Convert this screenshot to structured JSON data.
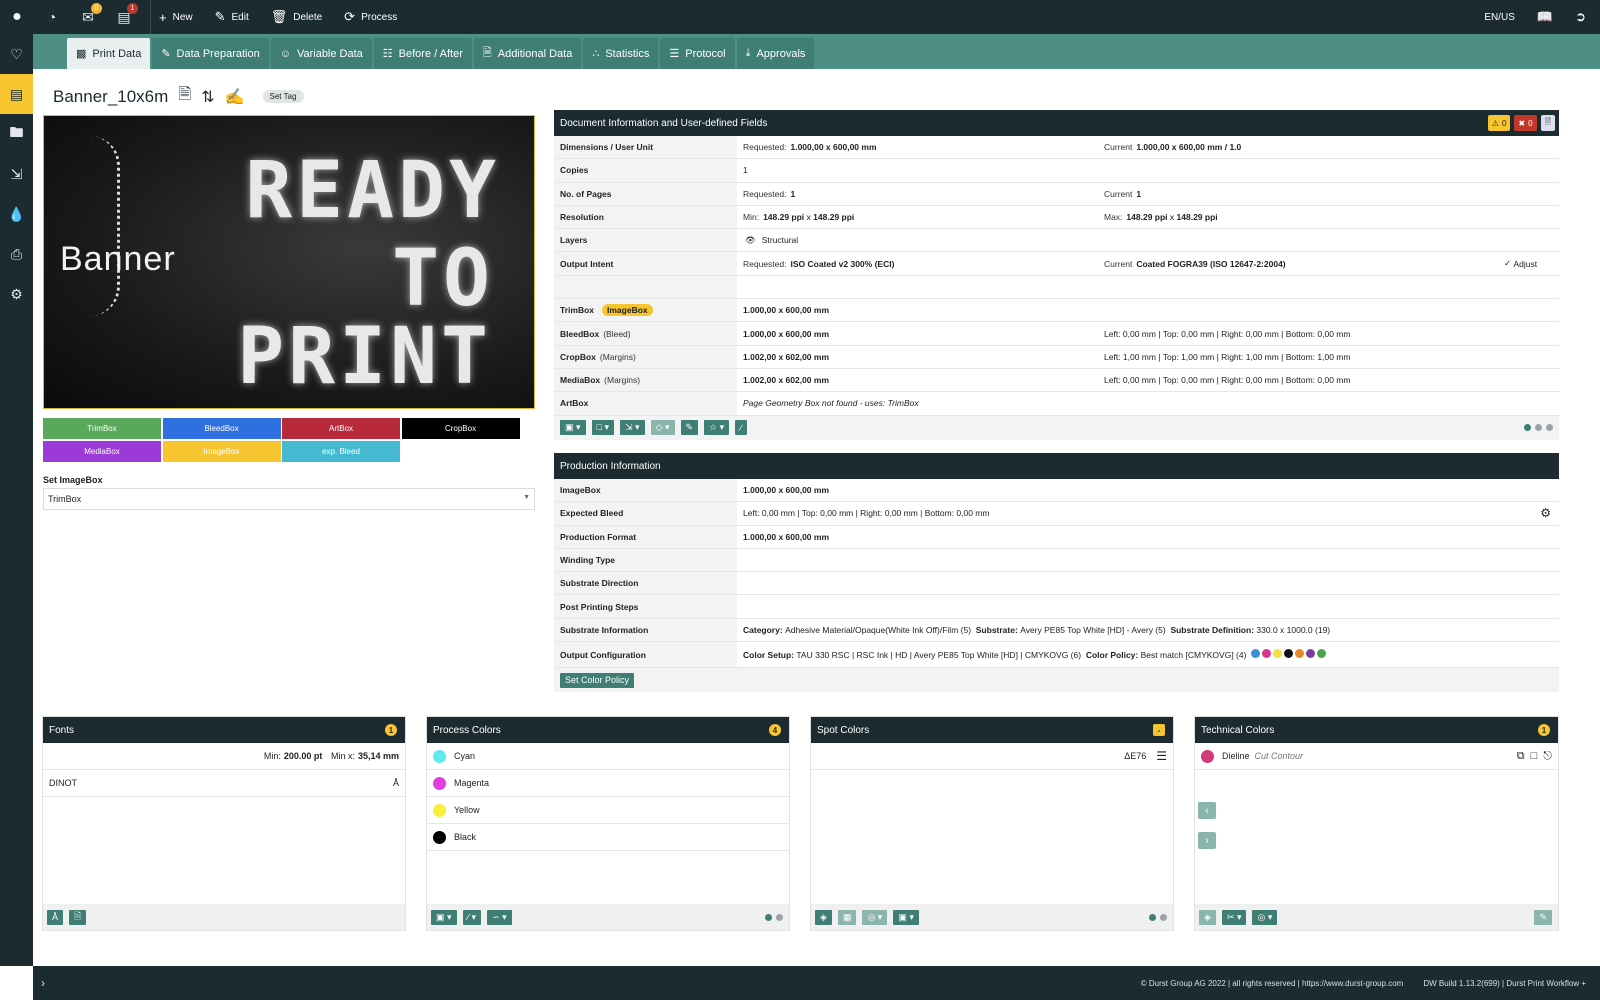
{
  "topbar": {
    "new": "New",
    "edit": "Edit",
    "delete": "Delete",
    "process": "Process",
    "badge_a": "0",
    "badge_b": "1",
    "locale": "EN/US"
  },
  "tabs": [
    "Print Data",
    "Data Preparation",
    "Variable Data",
    "Before / After",
    "Additional Data",
    "Statistics",
    "Protocol",
    "Approvals"
  ],
  "title": {
    "name": "Banner_10x6m",
    "set_tag": "Set Tag"
  },
  "preview": {
    "banner": "Banner",
    "l1": "READY",
    "l2": "TO",
    "l3": "PRINT"
  },
  "boxes": [
    {
      "label": "TrimBox",
      "color": "#5aa85a"
    },
    {
      "label": "BleedBox",
      "color": "#2f6fe0"
    },
    {
      "label": "ArtBox",
      "color": "#b8293a"
    },
    {
      "label": "CropBox",
      "color": "#000000"
    },
    {
      "label": "MediaBox",
      "color": "#9b3ad6"
    },
    {
      "label": "ImageBox",
      "color": "#f7c530"
    },
    {
      "label": "exp. Bleed",
      "color": "#45b9cf"
    }
  ],
  "set_imagebox": {
    "label": "Set ImageBox",
    "value": "TrimBox"
  },
  "doc_info": {
    "title": "Document Information and User-defined Fields",
    "warn_count": "0",
    "err_count": "0",
    "dim": {
      "k": "Dimensions / User Unit",
      "req_l": "Requested:",
      "req": "1.000,00 x 600,00 mm",
      "cur_l": "Current",
      "cur": "1.000,00 x 600,00 mm / 1.0"
    },
    "copies": {
      "k": "Copies",
      "v": "1"
    },
    "pages": {
      "k": "No. of Pages",
      "req_l": "Requested:",
      "req": "1",
      "cur_l": "Current",
      "cur": "1"
    },
    "res": {
      "k": "Resolution",
      "min_l": "Min:",
      "min_a": "148.29 ppi",
      "x": "x",
      "min_b": "148.29 ppi",
      "max_l": "Max:",
      "max_a": "148.29 ppi",
      "max_b": "148.29 ppi"
    },
    "layers": {
      "k": "Layers",
      "v": "Structural"
    },
    "intent": {
      "k": "Output Intent",
      "req_l": "Requested:",
      "req": "ISO Coated v2 300% (ECI)",
      "cur_l": "Current",
      "cur": "Coated FOGRA39 (ISO 12647-2:2004)",
      "adjust": "Adjust"
    },
    "trim": {
      "k": "TrimBox",
      "pill": "ImageBox",
      "v": "1.000,00 x 600,00 mm"
    },
    "bleed": {
      "k": "BleedBox",
      "sub": "(Bleed)",
      "v": "1.000,00 x 600,00 mm",
      "m": "Left: 0,00 mm | Top: 0,00 mm | Right: 0,00 mm | Bottom: 0,00 mm"
    },
    "crop": {
      "k": "CropBox",
      "sub": "(Margins)",
      "v": "1.002,00 x 602,00 mm",
      "m": "Left: 1,00 mm | Top: 1,00 mm | Right: 1,00 mm | Bottom: 1,00 mm"
    },
    "media": {
      "k": "MediaBox",
      "sub": "(Margins)",
      "v": "1.002,00 x 602,00 mm",
      "m": "Left: 0,00 mm | Top: 0,00 mm | Right: 0,00 mm | Bottom: 0,00 mm"
    },
    "art": {
      "k": "ArtBox",
      "v": "Page Geometry Box not found - uses: TrimBox"
    }
  },
  "prod": {
    "title": "Production Information",
    "imagebox": {
      "k": "ImageBox",
      "v": "1.000,00 x 600,00 mm"
    },
    "expbleed": {
      "k": "Expected Bleed",
      "v": "Left: 0,00 mm | Top: 0,00 mm | Right: 0,00 mm | Bottom: 0,00 mm"
    },
    "format": {
      "k": "Production Format",
      "v": "1.000,00 x 600,00 mm"
    },
    "winding": {
      "k": "Winding Type"
    },
    "subdir": {
      "k": "Substrate Direction"
    },
    "post": {
      "k": "Post Printing Steps"
    },
    "subinfo": {
      "k": "Substrate Information",
      "cat_l": "Category:",
      "cat": "Adhesive Material/Opaque(White Ink Off)/Film (5)",
      "sub_l": "Substrate:",
      "sub": "Avery PE85 Top White [HD] - Avery (5)",
      "def_l": "Substrate Definition:",
      "def": "330.0 x 1000.0 (19)"
    },
    "outcfg": {
      "k": "Output Configuration",
      "cs_l": "Color Setup:",
      "cs": "TAU 330 RSC | RSC Ink | HD | Avery PE85 Top White [HD] | CMYKOVG (6)",
      "cp_l": "Color Policy:",
      "cp": "Best match [CMYKOVG] (4)"
    },
    "ink_colors": [
      "#3a8fd8",
      "#d8358f",
      "#f2e040",
      "#111111",
      "#e58a2a",
      "#7a3e9c",
      "#4aa34a"
    ],
    "set_policy": "Set Color Policy"
  },
  "fonts": {
    "title": "Fonts",
    "count": "1",
    "min_l": "Min:",
    "min": "200.00 pt",
    "minx_l": "Min x:",
    "minx": "35,14 mm",
    "items": [
      "DINOT"
    ]
  },
  "process": {
    "title": "Process Colors",
    "count": "4",
    "items": [
      {
        "name": "Cyan",
        "color": "#5ee8f0"
      },
      {
        "name": "Magenta",
        "color": "#e23de0"
      },
      {
        "name": "Yellow",
        "color": "#f5f03a"
      },
      {
        "name": "Black",
        "color": "#000000"
      }
    ]
  },
  "spot": {
    "title": "Spot Colors",
    "count": "-",
    "delta": "ΔE76"
  },
  "tech": {
    "title": "Technical Colors",
    "count": "1",
    "item": "Dieline",
    "sub": "Cut Contour",
    "color": "#d23a7a"
  },
  "footer": {
    "copy": "© Durst Group AG 2022 | all rights reserved | https://www.durst-group.com",
    "build": "DW Build 1.13.2(699) | Durst Print Workflow +"
  }
}
